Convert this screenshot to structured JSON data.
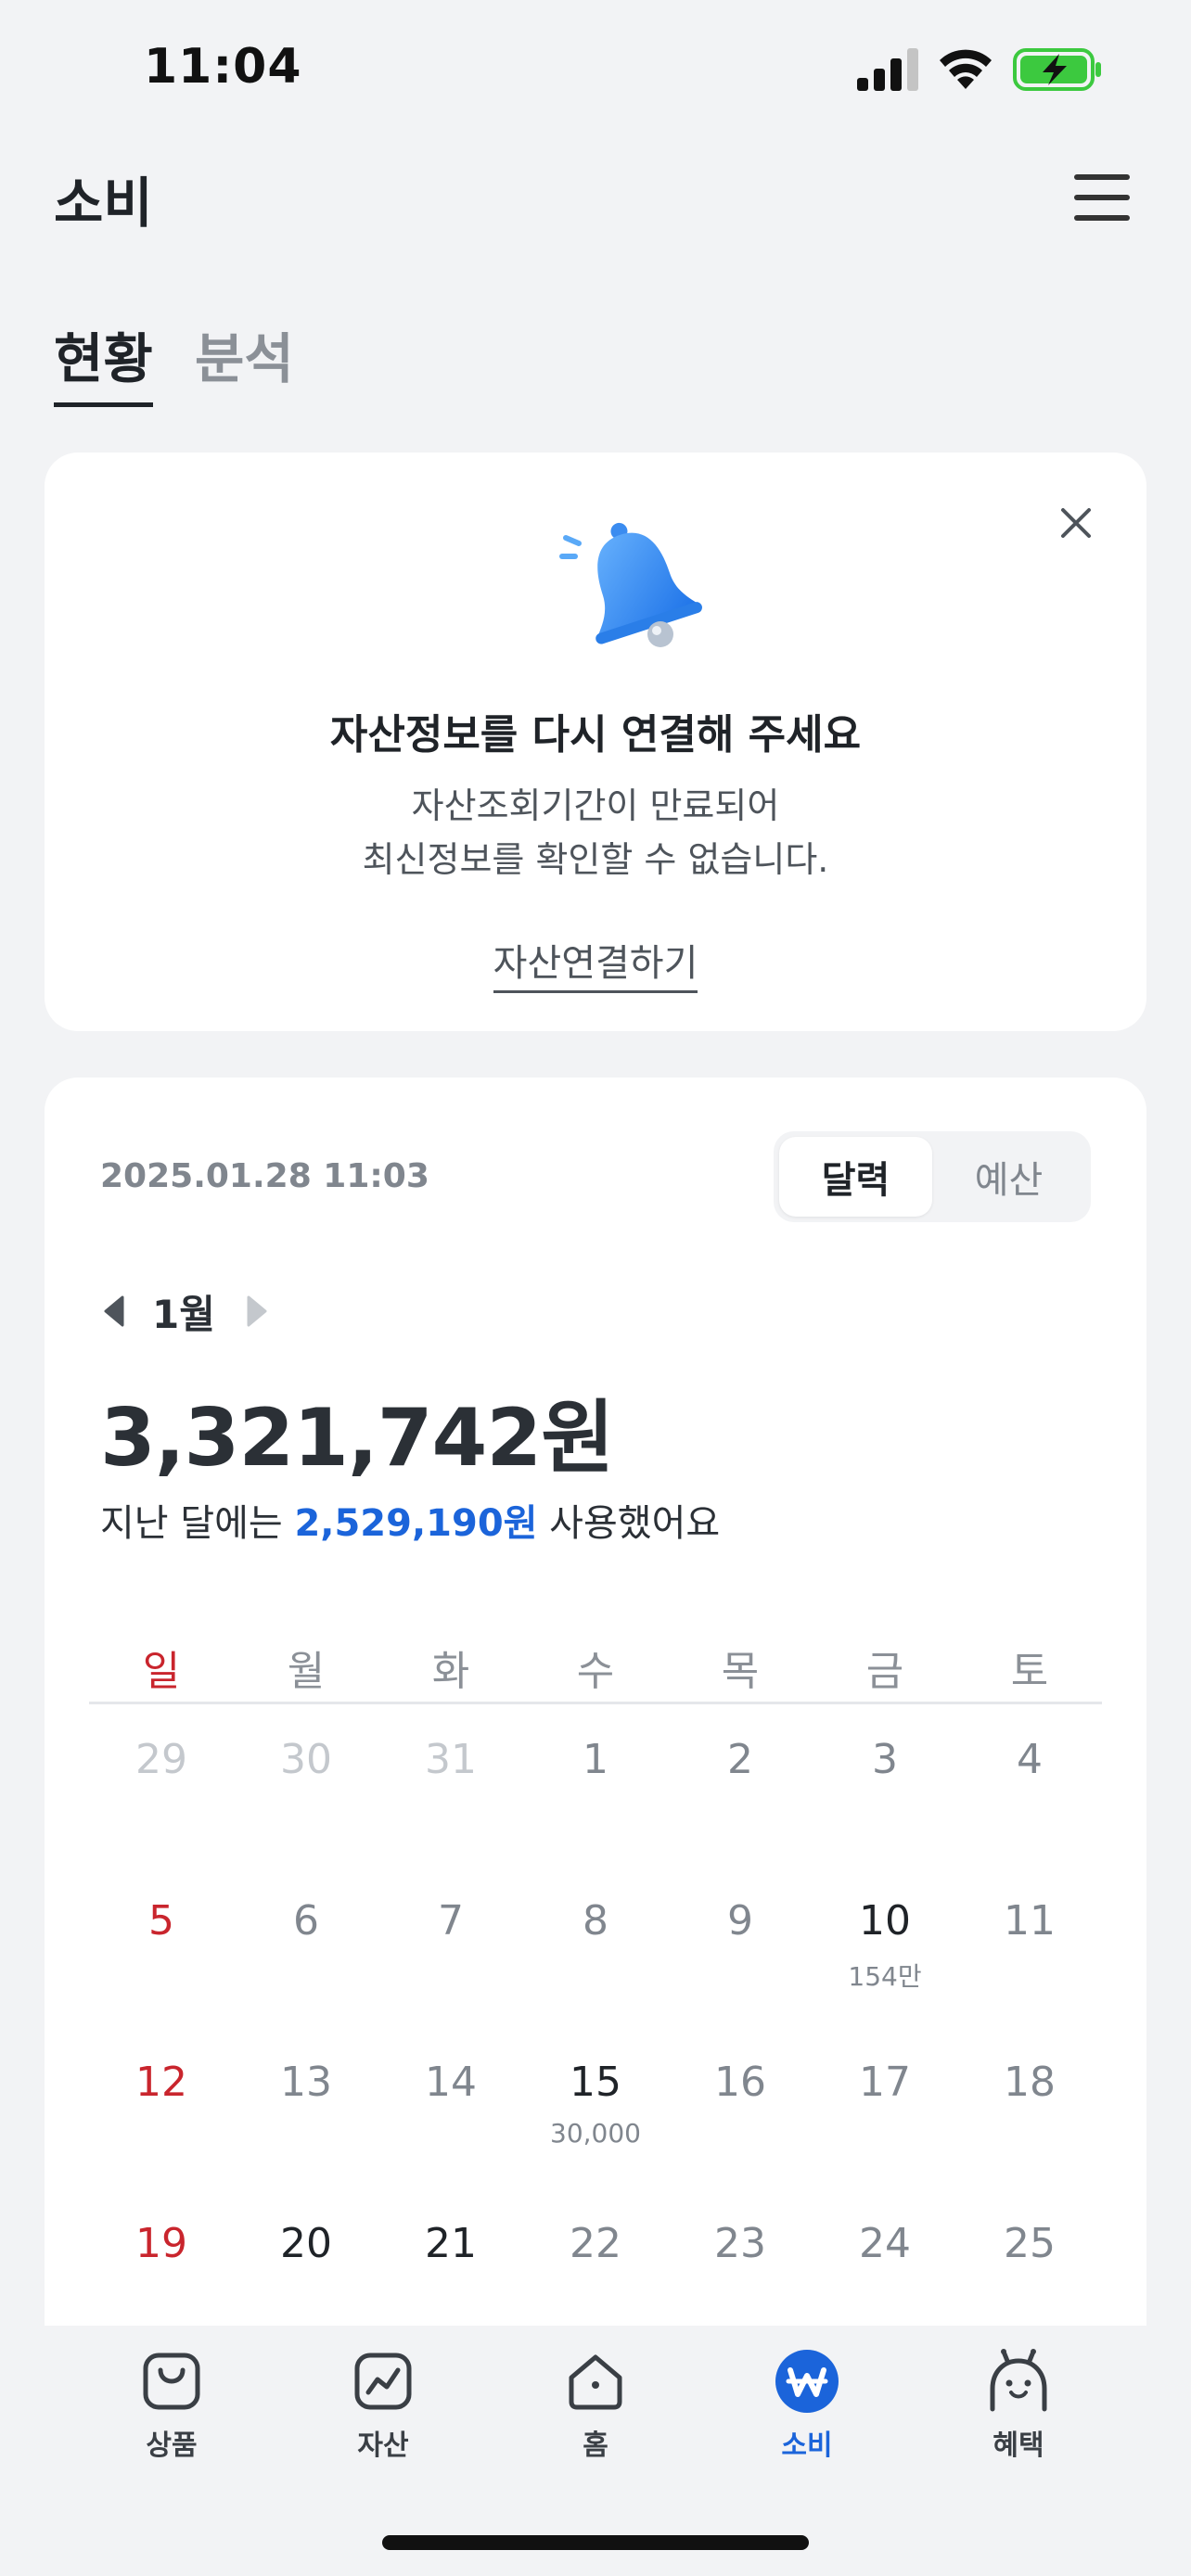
{
  "status_bar": {
    "time": "11:04",
    "icons": [
      "signal-icon",
      "wifi-icon",
      "battery-charging-icon"
    ],
    "battery_color": "#3cc93f"
  },
  "header": {
    "title": "소비",
    "menu_icon": "hamburger-menu-icon"
  },
  "tabs": [
    {
      "label": "현황",
      "active": true
    },
    {
      "label": "분석",
      "active": false
    }
  ],
  "notice": {
    "icon": "bell-icon",
    "title": "자산정보를 다시 연결해 주세요",
    "desc_line1": "자산조회기간이 만료되어",
    "desc_line2": "최신정보를 확인할 수 없습니다.",
    "link": "자산연결하기",
    "close_icon": "close-icon"
  },
  "summary": {
    "timestamp": "2025.01.28 11:03",
    "segments": [
      {
        "label": "달력",
        "active": true
      },
      {
        "label": "예산",
        "active": false
      }
    ],
    "month": "1월",
    "total": "3,321,742원",
    "compare_prefix": "지난 달에는 ",
    "compare_amount": "2,529,190원",
    "compare_suffix": " 사용했어요"
  },
  "calendar": {
    "weekdays": [
      "일",
      "월",
      "화",
      "수",
      "목",
      "금",
      "토"
    ],
    "weeks": [
      [
        {
          "day": "29",
          "other": true
        },
        {
          "day": "30",
          "other": true
        },
        {
          "day": "31",
          "other": true
        },
        {
          "day": "1"
        },
        {
          "day": "2"
        },
        {
          "day": "3"
        },
        {
          "day": "4"
        }
      ],
      [
        {
          "day": "5"
        },
        {
          "day": "6"
        },
        {
          "day": "7"
        },
        {
          "day": "8"
        },
        {
          "day": "9"
        },
        {
          "day": "10",
          "amount": "154만"
        },
        {
          "day": "11"
        }
      ],
      [
        {
          "day": "12"
        },
        {
          "day": "13"
        },
        {
          "day": "14"
        },
        {
          "day": "15",
          "amount": "30,000"
        },
        {
          "day": "16"
        },
        {
          "day": "17"
        },
        {
          "day": "18"
        }
      ],
      [
        {
          "day": "19"
        },
        {
          "day": "20",
          "bold": true
        },
        {
          "day": "21",
          "bold": true
        },
        {
          "day": "22"
        },
        {
          "day": "23"
        },
        {
          "day": "24"
        },
        {
          "day": "25"
        }
      ]
    ],
    "sunday_color": "#c9252d"
  },
  "bottom_nav": [
    {
      "label": "상품",
      "icon": "shopping-bag-icon",
      "active": false
    },
    {
      "label": "자산",
      "icon": "chart-icon",
      "active": false
    },
    {
      "label": "홈",
      "icon": "home-icon",
      "active": false
    },
    {
      "label": "소비",
      "icon": "won-icon",
      "active": true
    },
    {
      "label": "혜택",
      "icon": "benefit-character-icon",
      "active": false
    }
  ],
  "accent_color": "#1b64da"
}
